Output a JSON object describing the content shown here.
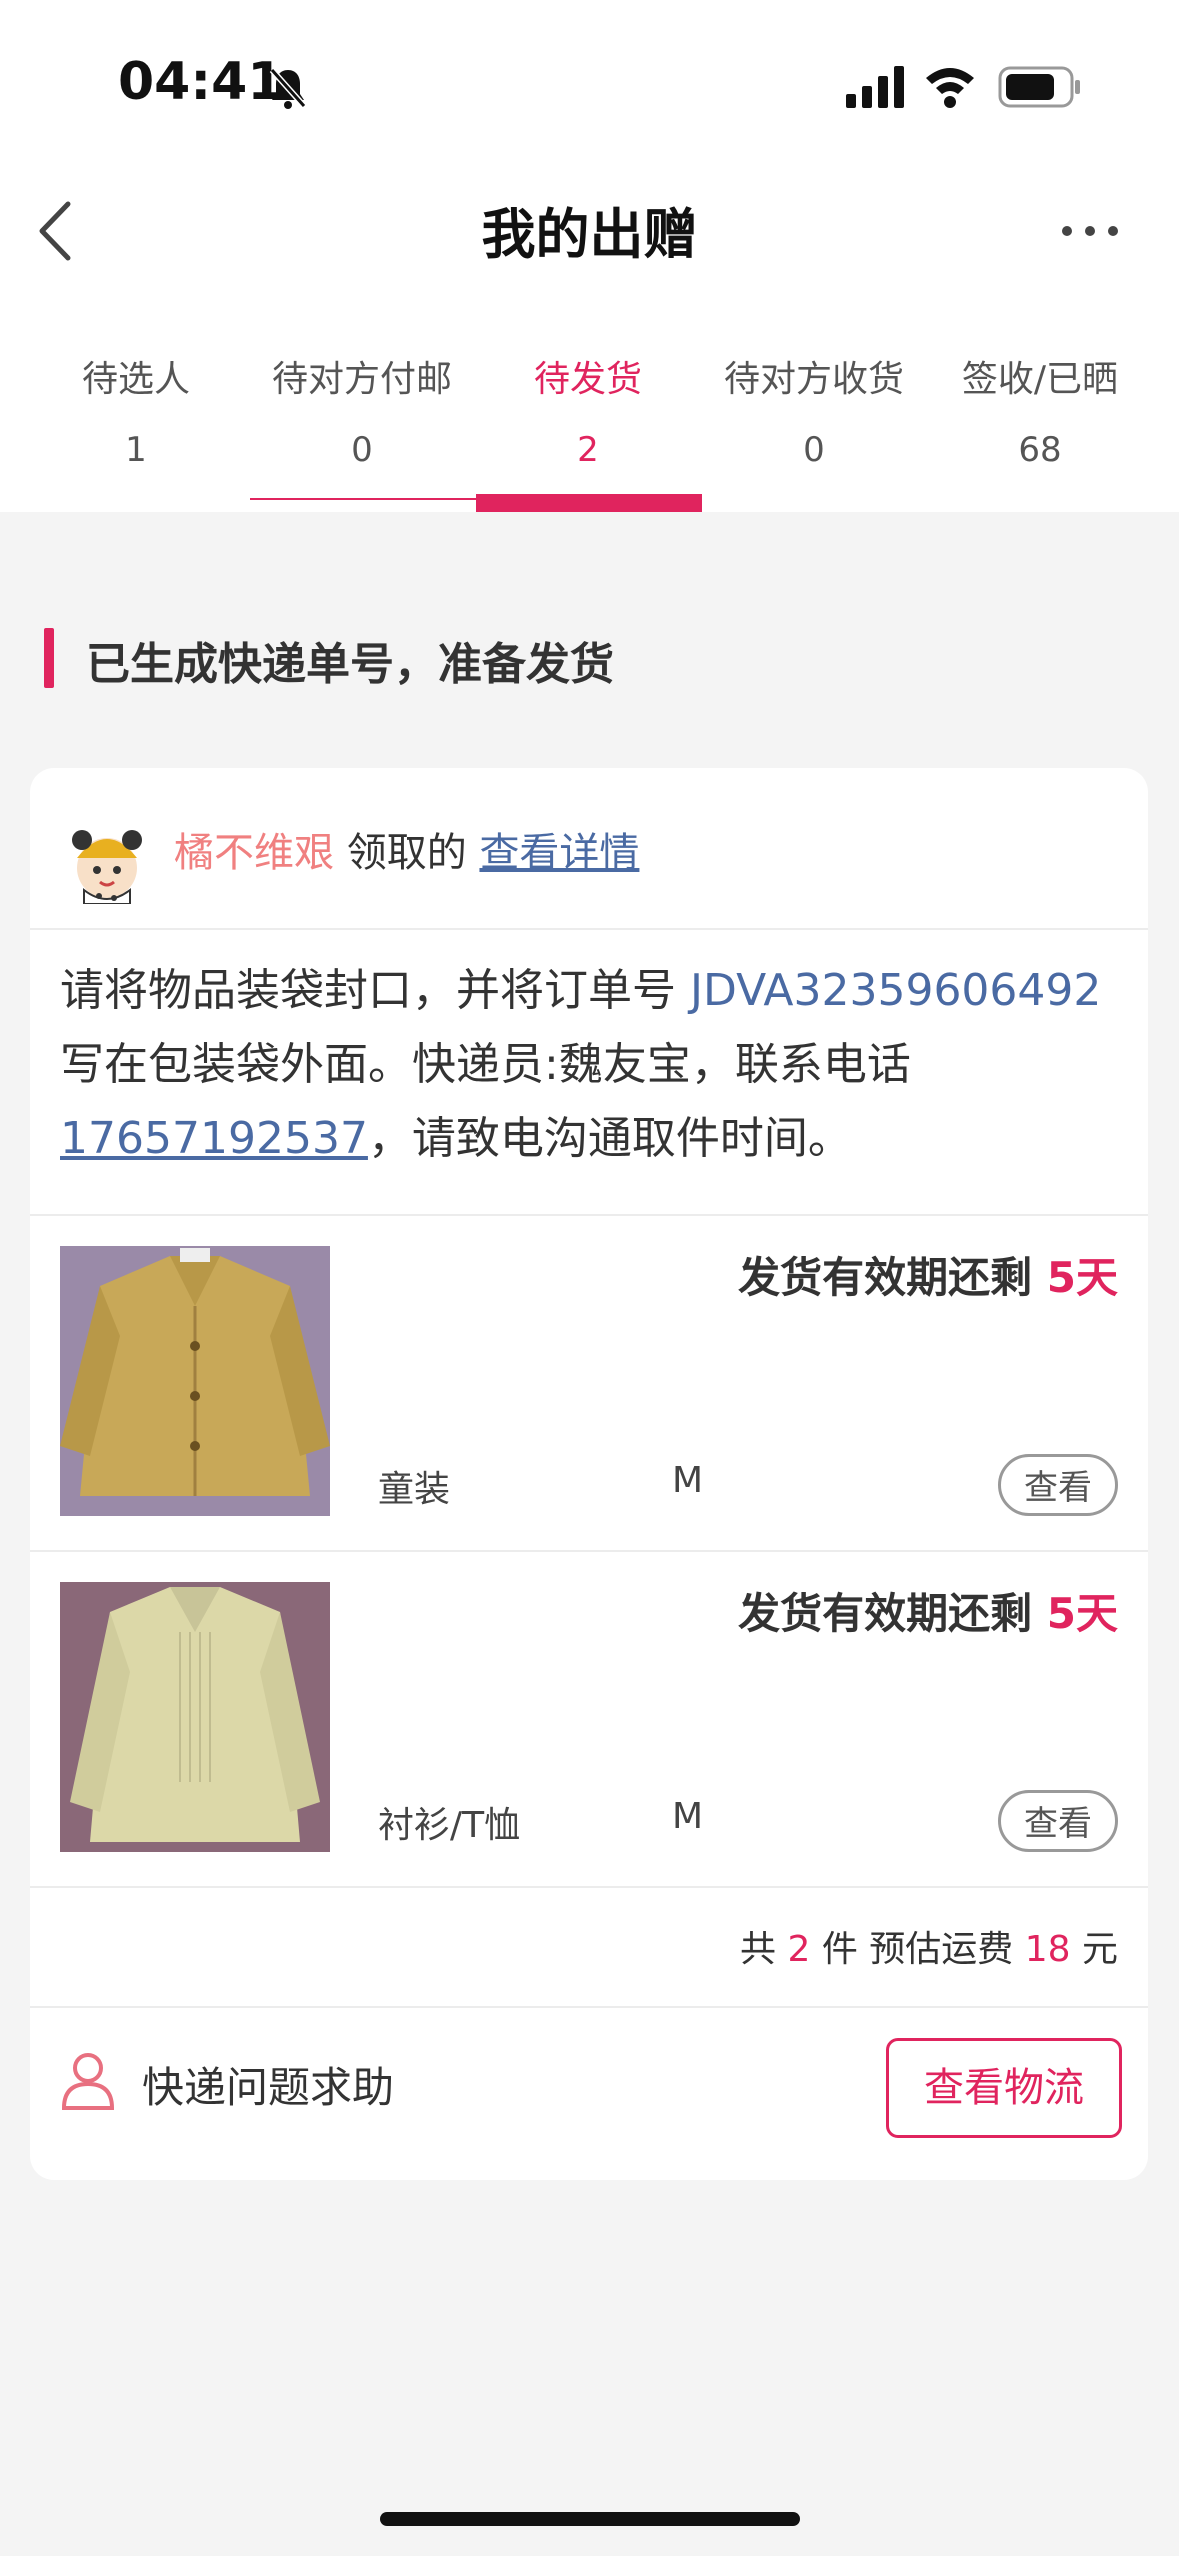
{
  "status": {
    "time": "04:41"
  },
  "header": {
    "title": "我的出赠"
  },
  "tabs": [
    {
      "label": "待选人",
      "count": "1"
    },
    {
      "label": "待对方付邮",
      "count": "0"
    },
    {
      "label": "待发货",
      "count": "2"
    },
    {
      "label": "待对方收货",
      "count": "0"
    },
    {
      "label": "签收/已晒",
      "count": "68"
    }
  ],
  "section": {
    "title": "已生成快递单号，准备发货"
  },
  "card": {
    "user_name": "橘不维艰",
    "claimed_text": " 领取的 ",
    "details_link": "查看详情",
    "instruction": {
      "part1": "请将物品装袋封口，并将订单号 ",
      "order_no": "JDVA32359606492",
      "part2": " 写在包装袋外面。快递员:魏友宝，联系电话",
      "phone": "17657192537",
      "part3": "，请致电沟通取件时间。"
    },
    "items": [
      {
        "deadline_prefix": "发货有效期还剩 ",
        "days": "5天",
        "category": "童装",
        "size": "M",
        "view_label": "查看"
      },
      {
        "deadline_prefix": "发货有效期还剩 ",
        "days": "5天",
        "category": "衬衫/T恤",
        "size": "M",
        "view_label": "查看"
      }
    ],
    "summary": {
      "prefix": "共 ",
      "count": "2",
      "mid": " 件 预估运费 ",
      "fee": "18",
      "suffix": " 元"
    },
    "help_text": "快递问题求助",
    "logistics_label": "查看物流"
  },
  "colors": {
    "accent": "#e0245e",
    "link": "#4a6aa3",
    "username": "#f08080"
  }
}
